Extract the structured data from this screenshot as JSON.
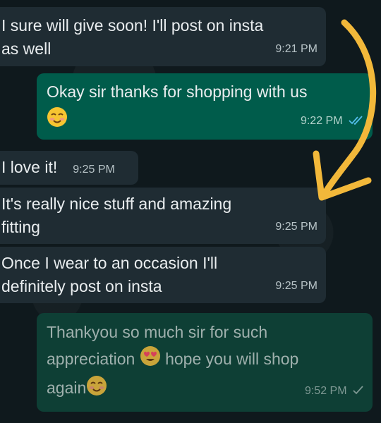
{
  "messages": [
    {
      "id": "m1",
      "direction": "incoming",
      "text": "I sure will give soon! I'll post on insta\nas well",
      "time": "9:21 PM"
    },
    {
      "id": "m2",
      "direction": "outgoing",
      "text": "Okay sir thanks for shopping with us",
      "emoji": "smiling-blush-emoji",
      "time": "9:22 PM",
      "status": "read"
    },
    {
      "id": "m3",
      "direction": "incoming",
      "text": "I love it!",
      "time": "9:25 PM"
    },
    {
      "id": "m4",
      "direction": "incoming",
      "text": "It's really nice stuff and amazing\nfitting",
      "time": "9:25 PM"
    },
    {
      "id": "m5",
      "direction": "incoming",
      "text": "Once I wear to an occasion I'll\ndefinitely post on insta",
      "time": "9:25 PM"
    },
    {
      "id": "m6",
      "direction": "outgoing",
      "text_parts": [
        "Thankyou so much sir for such",
        "appreciation",
        "hope you will shop",
        "again"
      ],
      "emojis": [
        "heart-eyes-emoji",
        "smiling-blush-emoji"
      ],
      "time": "9:52 PM",
      "status": "sent"
    }
  ],
  "annotation": {
    "type": "hand-drawn-arrow",
    "color": "#f2b83a"
  },
  "colors": {
    "incoming_bubble": "#1f2c33",
    "outgoing_bubble": "#005c4b",
    "read_ticks": "#53bdeb"
  }
}
